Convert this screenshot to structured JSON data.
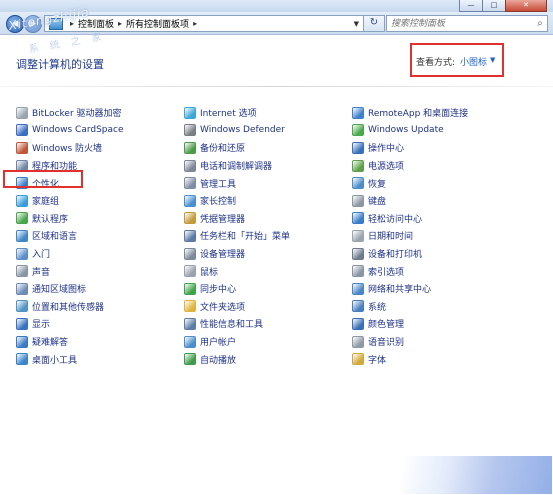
{
  "window": {
    "min": "—",
    "max": "□",
    "close": "✕"
  },
  "address": {
    "root": "控制面板",
    "current": "所有控制面板项"
  },
  "search": {
    "placeholder": "搜索控制面板"
  },
  "watermark": {
    "line1": "Xitongzhijia",
    "line2": "系 统 之 家"
  },
  "page": {
    "title": "调整计算机的设置",
    "view_label": "查看方式:",
    "view_value": "小图标"
  },
  "columns": [
    [
      {
        "label": "BitLocker 驱动器加密",
        "icon": "bitlocker-icon",
        "color": "#9aa4b0"
      },
      {
        "label": "Windows CardSpace",
        "icon": "cardspace-icon",
        "color": "#3b6fc2"
      },
      {
        "label": "Windows 防火墙",
        "icon": "firewall-icon",
        "color": "#c0573a"
      },
      {
        "label": "程序和功能",
        "icon": "programs-icon",
        "color": "#6e86a6"
      },
      {
        "label": "个性化",
        "icon": "personalization-icon",
        "color": "#3a7dc9"
      },
      {
        "label": "家庭组",
        "icon": "homegroup-icon",
        "color": "#3b9dd8"
      },
      {
        "label": "默认程序",
        "icon": "default-programs-icon",
        "color": "#4aa54a"
      },
      {
        "label": "区域和语言",
        "icon": "region-icon",
        "color": "#3f86c4"
      },
      {
        "label": "入门",
        "icon": "getting-started-icon",
        "color": "#5f8fc9"
      },
      {
        "label": "声音",
        "icon": "sound-icon",
        "color": "#8a96a6"
      },
      {
        "label": "通知区域图标",
        "icon": "notification-icon",
        "color": "#6c8bb5"
      },
      {
        "label": "位置和其他传感器",
        "icon": "sensor-icon",
        "color": "#4f94c4"
      },
      {
        "label": "显示",
        "icon": "display-icon",
        "color": "#3972c0"
      },
      {
        "label": "疑难解答",
        "icon": "troubleshoot-icon",
        "color": "#3a79c4"
      },
      {
        "label": "桌面小工具",
        "icon": "gadgets-icon",
        "color": "#3b84c9"
      }
    ],
    [
      {
        "label": "Internet 选项",
        "icon": "internet-icon",
        "color": "#3ea5d8"
      },
      {
        "label": "Windows Defender",
        "icon": "defender-icon",
        "color": "#7a7f86"
      },
      {
        "label": "备份和还原",
        "icon": "backup-icon",
        "color": "#4a9a4a"
      },
      {
        "label": "电话和调制解调器",
        "icon": "phone-icon",
        "color": "#7d8797"
      },
      {
        "label": "管理工具",
        "icon": "admin-tools-icon",
        "color": "#7f8ea3"
      },
      {
        "label": "家长控制",
        "icon": "parental-icon",
        "color": "#4b8fd0"
      },
      {
        "label": "凭据管理器",
        "icon": "credential-icon",
        "color": "#c49a3a"
      },
      {
        "label": "任务栏和「开始」菜单",
        "icon": "taskbar-icon",
        "color": "#5a7aa5"
      },
      {
        "label": "设备管理器",
        "icon": "device-manager-icon",
        "color": "#7d8a9a"
      },
      {
        "label": "鼠标",
        "icon": "mouse-icon",
        "color": "#9aa2ac"
      },
      {
        "label": "同步中心",
        "icon": "sync-icon",
        "color": "#3fa34a"
      },
      {
        "label": "文件夹选项",
        "icon": "folder-icon",
        "color": "#e0b440"
      },
      {
        "label": "性能信息和工具",
        "icon": "performance-icon",
        "color": "#5d7ca8"
      },
      {
        "label": "用户帐户",
        "icon": "user-accounts-icon",
        "color": "#4d8dcb"
      },
      {
        "label": "自动播放",
        "icon": "autoplay-icon",
        "color": "#3f9b4a"
      }
    ],
    [
      {
        "label": "RemoteApp 和桌面连接",
        "icon": "remoteapp-icon",
        "color": "#3f80c8"
      },
      {
        "label": "Windows Update",
        "icon": "windows-update-icon",
        "color": "#48a84a"
      },
      {
        "label": "操作中心",
        "icon": "action-center-icon",
        "color": "#3a6fb9"
      },
      {
        "label": "电源选项",
        "icon": "power-icon",
        "color": "#5ca04b"
      },
      {
        "label": "恢复",
        "icon": "recovery-icon",
        "color": "#4c8ec8"
      },
      {
        "label": "键盘",
        "icon": "keyboard-icon",
        "color": "#8d96a3"
      },
      {
        "label": "轻松访问中心",
        "icon": "ease-of-access-icon",
        "color": "#3a7cc7"
      },
      {
        "label": "日期和时间",
        "icon": "clock-icon",
        "color": "#9aa3ae"
      },
      {
        "label": "设备和打印机",
        "icon": "printer-icon",
        "color": "#6d7b8d"
      },
      {
        "label": "索引选项",
        "icon": "indexing-icon",
        "color": "#8a95a4"
      },
      {
        "label": "网络和共享中心",
        "icon": "network-icon",
        "color": "#4a86c6"
      },
      {
        "label": "系统",
        "icon": "system-icon",
        "color": "#4a7fbe"
      },
      {
        "label": "颜色管理",
        "icon": "color-management-icon",
        "color": "#3b6fb5"
      },
      {
        "label": "语音识别",
        "icon": "speech-icon",
        "color": "#8f98a3"
      },
      {
        "label": "字体",
        "icon": "fonts-icon",
        "color": "#d2a83a"
      }
    ]
  ]
}
